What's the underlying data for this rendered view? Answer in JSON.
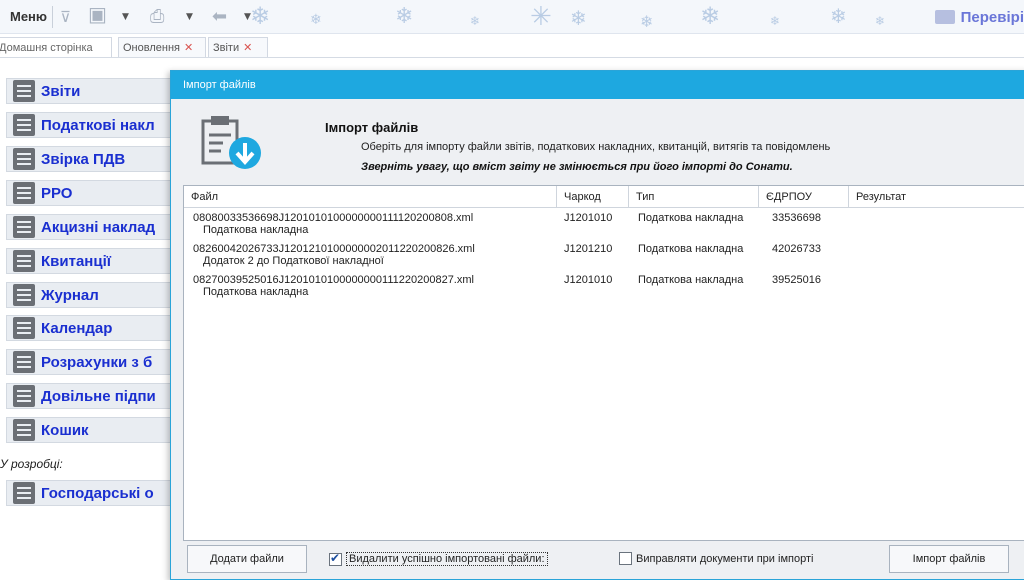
{
  "toolbar": {
    "menu_label": "Меню",
    "check_label": "Перевірі",
    "icons": [
      "save-icon",
      "print-icon",
      "back-arrow-icon"
    ]
  },
  "tabs": [
    {
      "label": "Домашня сторінка",
      "closable": false
    },
    {
      "label": "Оновлення",
      "closable": true
    },
    {
      "label": "Звіти",
      "closable": true
    }
  ],
  "sidebar": {
    "items": [
      {
        "label": "Звіти",
        "icon": "reports-icon"
      },
      {
        "label": "Податкові накл",
        "icon": "tax-invoice-icon"
      },
      {
        "label": "Звірка ПДВ",
        "icon": "vat-reconcile-icon"
      },
      {
        "label": "РРО",
        "icon": "cash-register-icon"
      },
      {
        "label": "Акцизні наклад",
        "icon": "excise-invoice-icon"
      },
      {
        "label": "Квитанції",
        "icon": "envelope-icon"
      },
      {
        "label": "Журнал",
        "icon": "journal-icon"
      },
      {
        "label": "Календар",
        "icon": "calendar-icon"
      },
      {
        "label": "Розрахунки з б",
        "icon": "calculator-icon"
      },
      {
        "label": "Довільне підпи",
        "icon": "lock-icon"
      },
      {
        "label": "Кошик",
        "icon": "trash-icon"
      }
    ],
    "dev_label": "У розробці:",
    "dev_items": [
      {
        "label": "Господарські о",
        "icon": "document-icon"
      }
    ]
  },
  "dialog": {
    "title": "Імпорт файлів",
    "header_title": "Імпорт файлів",
    "header_subtitle": "Оберіть для імпорту файли звітів, податкових накладних, квитанцій, витягів та повідомлень",
    "header_warning": "Зверніть увагу, що вміст звіту не змінюється при його імпорті до Сонати.",
    "columns": [
      "Файл",
      "Чаркод",
      "Тип",
      "ЄДРПОУ",
      "Результат"
    ],
    "rows": [
      {
        "file": "08080033536698J1201010100000000111120200808.xml",
        "desc": "Податкова накладна",
        "code": "J1201010",
        "type": "Податкова накладна",
        "edrpou": "33536698",
        "result": ""
      },
      {
        "file": "08260042026733J1201210100000002011220200826.xml",
        "desc": "Додаток 2 до Податкової накладної",
        "code": "J1201210",
        "type": "Податкова накладна",
        "edrpou": "42026733",
        "result": ""
      },
      {
        "file": "08270039525016J1201010100000000111220200827.xml",
        "desc": "Податкова накладна",
        "code": "J1201010",
        "type": "Податкова накладна",
        "edrpou": "39525016",
        "result": ""
      }
    ],
    "add_files_label": "Додати файли",
    "delete_imported_label": "Видалити успішно імпортовані файли:",
    "delete_imported_checked": true,
    "fix_documents_label": "Виправляти документи при імпорті",
    "fix_documents_checked": false,
    "import_button_label": "Імпорт файлів"
  }
}
